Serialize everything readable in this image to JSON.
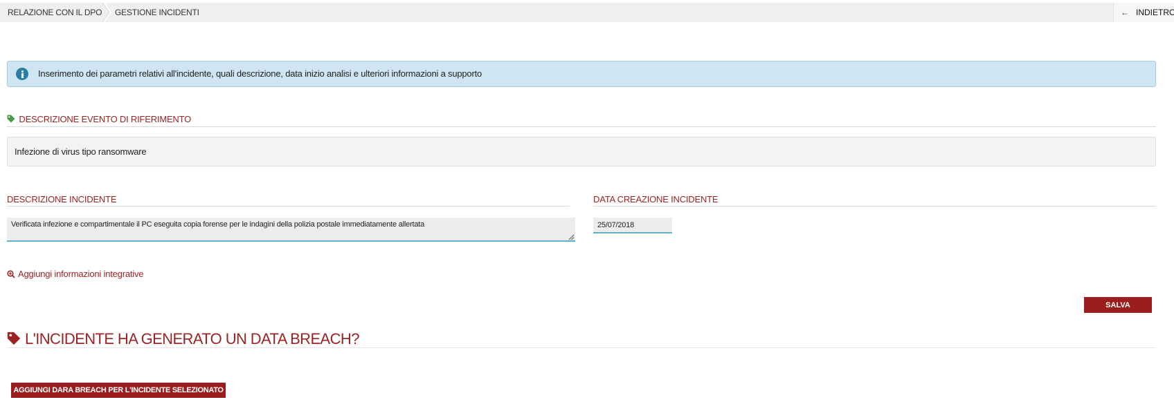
{
  "breadcrumb": {
    "items": [
      "RELAZIONE CON IL DPO",
      "GESTIONE INCIDENTI"
    ],
    "back_label": "INDIETRO"
  },
  "info": {
    "text": "Inserimento dei parametri relativi all'incidente, quali descrizione, data inizio analisi e ulteriori informazioni a supporto"
  },
  "event_section": {
    "title": "DESCRIZIONE EVENTO DI RIFERIMENTO",
    "value": "Infezione di virus tipo ransomware"
  },
  "incident_description": {
    "label": "DESCRIZIONE INCIDENTE",
    "value": "Verificata infezione e compartimentale il PC eseguita copia forense per le indagini della polizia postale immediatamente allertata"
  },
  "incident_date": {
    "label": "DATA CREAZIONE INCIDENTE",
    "value": "25/07/2018"
  },
  "add_info_link": "Aggiungi informazioni integrative",
  "save_label": "SALVA",
  "breach_section": {
    "title": "L'INCIDENTE HA GENERATO UN DATA BREACH?",
    "add_button": "AGGIUNGI DARA BREACH PER L'INCIDENTE SELEZIONATO"
  },
  "colors": {
    "accent": "#9b2323",
    "button": "#9b1e1e",
    "info_bg": "#cfe6f2",
    "field_underline": "#5fb0c9",
    "tag_icon_small": "#4a9a4a"
  }
}
